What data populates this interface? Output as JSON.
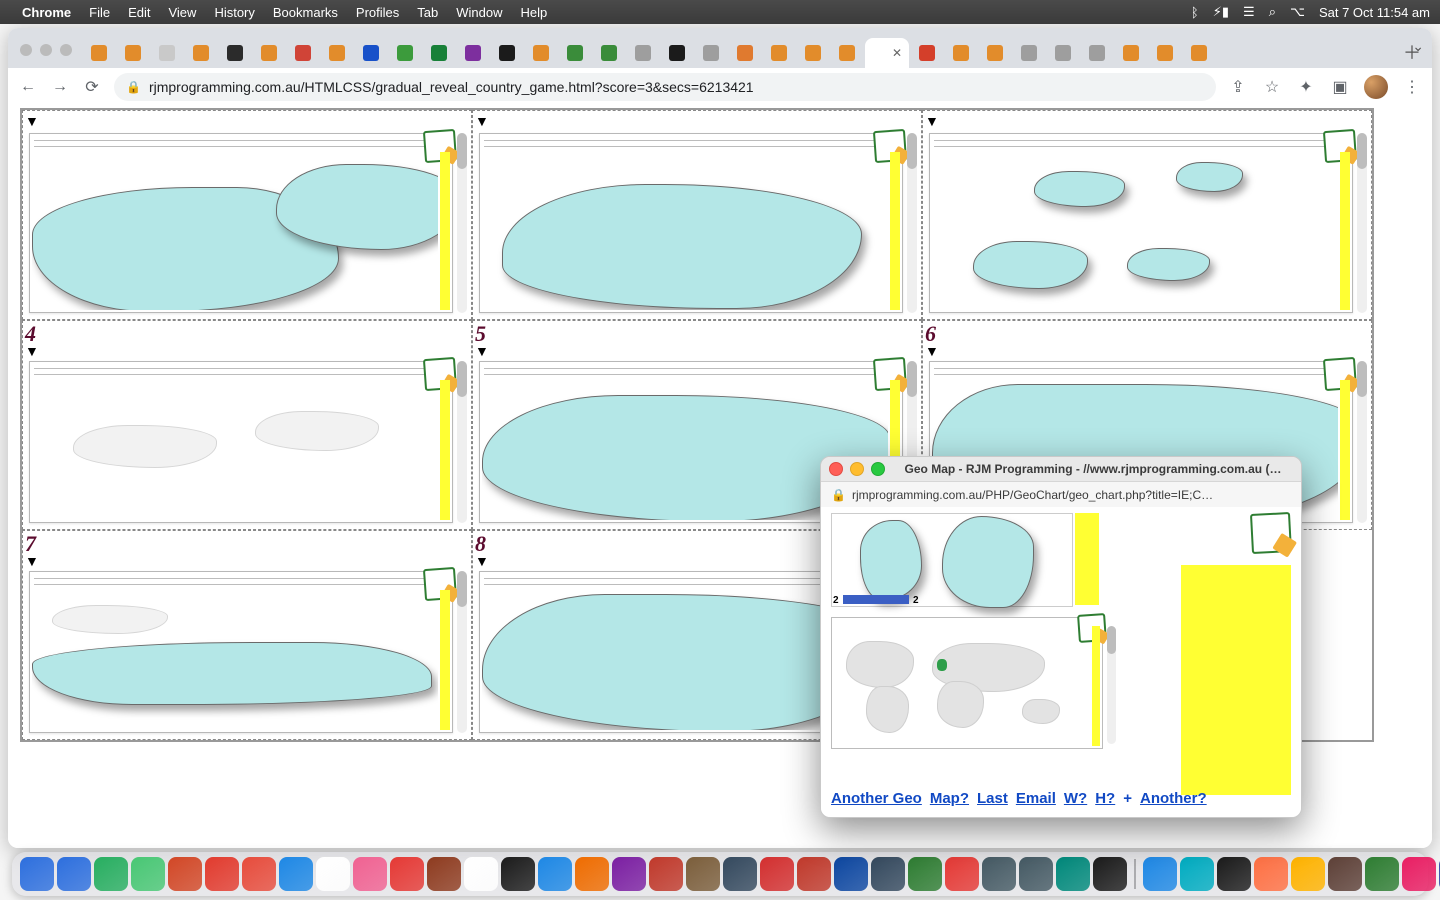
{
  "menubar": {
    "app": "Chrome",
    "items": [
      "File",
      "Edit",
      "View",
      "History",
      "Bookmarks",
      "Profiles",
      "Tab",
      "Window",
      "Help"
    ],
    "clock": "Sat 7 Oct  11:54 am",
    "status_icons": [
      "bluetooth",
      "battery-charging",
      "wifi",
      "spotlight",
      "control-centre"
    ]
  },
  "browser": {
    "url": "rjmprogramming.com.au/HTMLCSS/gradual_reveal_country_game.html?score=3&secs=6213421",
    "toolbar_icons": {
      "back": "←",
      "forward": "→",
      "reload": "⟳",
      "share": "⇪",
      "star": "☆",
      "ext": "✦",
      "panel": "▣",
      "menu": "⋮"
    },
    "tabs_count": 33,
    "active_tab_index": 23,
    "favicon_colors": [
      "#e28c2b",
      "#e28c2b",
      "#c9c9c9",
      "#e28c2b",
      "#2b2b2b",
      "#e28c2b",
      "#d04437",
      "#e28c2b",
      "#1851c9",
      "#3c9b3c",
      "#188038",
      "#7d2f9e",
      "#1b1b1b",
      "#e28c2b",
      "#3a8c3a",
      "#3a8c3a",
      "#9e9e9e",
      "#1b1b1b",
      "#9e9e9e",
      "#e07a2f",
      "#e28c2b",
      "#e28c2b",
      "#e28c2b",
      "#ffffff",
      "#d43f2a",
      "#e28c2b",
      "#e28c2b",
      "#9e9e9e",
      "#9e9e9e",
      "#9e9e9e",
      "#e28c2b",
      "#e28c2b",
      "#e28c2b"
    ]
  },
  "game": {
    "cells": [
      {
        "num": "",
        "tri": "▼",
        "showNum": false
      },
      {
        "num": "",
        "tri": "▼",
        "showNum": false
      },
      {
        "num": "",
        "tri": "▼",
        "showNum": false
      },
      {
        "num": "4",
        "tri": "▼",
        "showNum": true
      },
      {
        "num": "5",
        "tri": "▼",
        "showNum": true
      },
      {
        "num": "6",
        "tri": "▼",
        "showNum": true
      },
      {
        "num": "7",
        "tri": "▼",
        "showNum": true
      },
      {
        "num": "8",
        "tri": "▼",
        "showNum": true
      }
    ]
  },
  "popup": {
    "title": "Geo Map - RJM Programming - //www.rjmprogramming.com.au (…",
    "url": "rjmprogramming.com.au/PHP/GeoChart/geo_chart.php?title=IE;C…",
    "bar_left": "2",
    "bar_right": "2",
    "links": [
      "Another Geo",
      "Map?",
      "Last",
      "Email",
      "W?",
      "H?",
      "+",
      "Another?"
    ]
  },
  "dock": {
    "colors": [
      "#2d6fde",
      "#2d6fde",
      "#27ae60",
      "#48c774",
      "#d24726",
      "#e23b2e",
      "#e74c3c",
      "#1e88e5",
      "#ffffff",
      "#f06292",
      "#e53935",
      "#8e3b1f",
      "#ffffff",
      "#1b1b1b",
      "#1e88e5",
      "#ef6c00",
      "#7b1fa2",
      "#c0392b",
      "#7b5e3b",
      "#34495e",
      "#d32f2f",
      "#c0392b",
      "#0d47a1",
      "#34495e",
      "#2e7d32",
      "#e53935",
      "#455a64",
      "#455a64",
      "#00897b",
      "#1b1b1b",
      "#1e88e5",
      "#00acc1",
      "#1b1b1b",
      "#ff7043",
      "#ffb300",
      "#5d4037",
      "#2e7d32",
      "#e91e63",
      "#3949ab",
      "#455a64"
    ]
  }
}
